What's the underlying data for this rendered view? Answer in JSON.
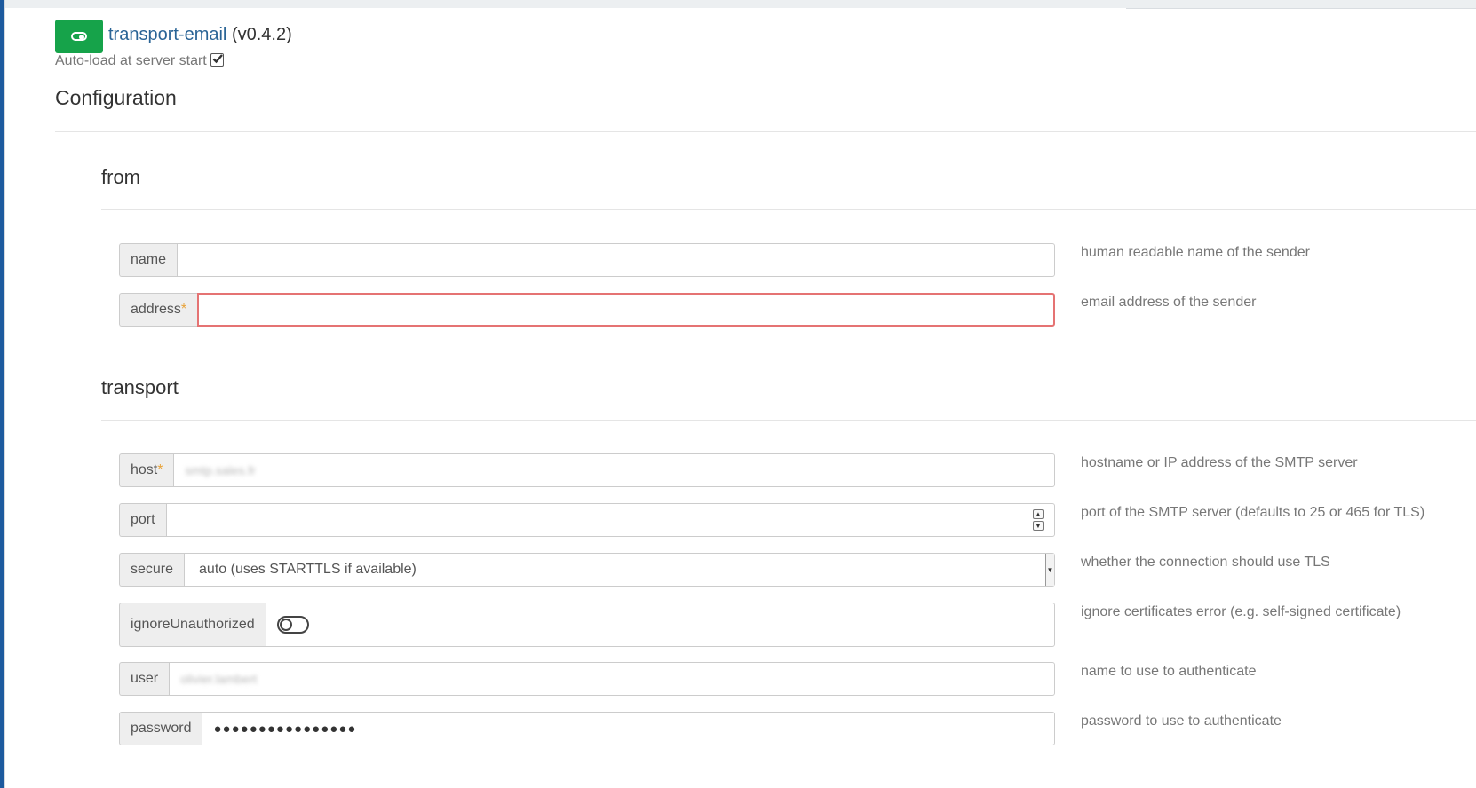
{
  "plugin": {
    "name": "transport-email",
    "version": "(v0.4.2)",
    "autoload_label": "Auto-load at server start",
    "autoload_checked": true,
    "enabled": true,
    "accent_color": "#16a34a"
  },
  "config": {
    "heading": "Configuration",
    "sections": {
      "from": {
        "title": "from",
        "fields": {
          "name": {
            "label": "name",
            "value": "",
            "help": "human readable name of the sender"
          },
          "address": {
            "label": "address",
            "required_mark": "*",
            "value": "",
            "help": "email address of the sender",
            "error": true
          }
        }
      },
      "transport": {
        "title": "transport",
        "fields": {
          "host": {
            "label": "host",
            "required_mark": "*",
            "value": "smtp.sales.fr",
            "help": "hostname or IP address of the SMTP server"
          },
          "port": {
            "label": "port",
            "value": "",
            "help": "port of the SMTP server (defaults to 25 or 465 for TLS)"
          },
          "secure": {
            "label": "secure",
            "value": "auto (uses STARTTLS if available)",
            "help": "whether the connection should use TLS"
          },
          "ignoreUnauthorized": {
            "label": "ignoreUnauthorized",
            "value": false,
            "help": "ignore certificates error (e.g. self-signed certificate)"
          },
          "user": {
            "label": "user",
            "value": "olivier.lambert",
            "help": "name to use to authenticate"
          },
          "password": {
            "label": "password",
            "value": "●●●●●●●●●●●●●●●●",
            "help": "password to use to authenticate"
          }
        }
      }
    }
  },
  "icons": {
    "toggle": "toggle-on-icon",
    "check": "check-icon",
    "spinner_up": "chevron-up-icon",
    "spinner_down": "chevron-down-icon",
    "select": "caret-down-icon"
  }
}
